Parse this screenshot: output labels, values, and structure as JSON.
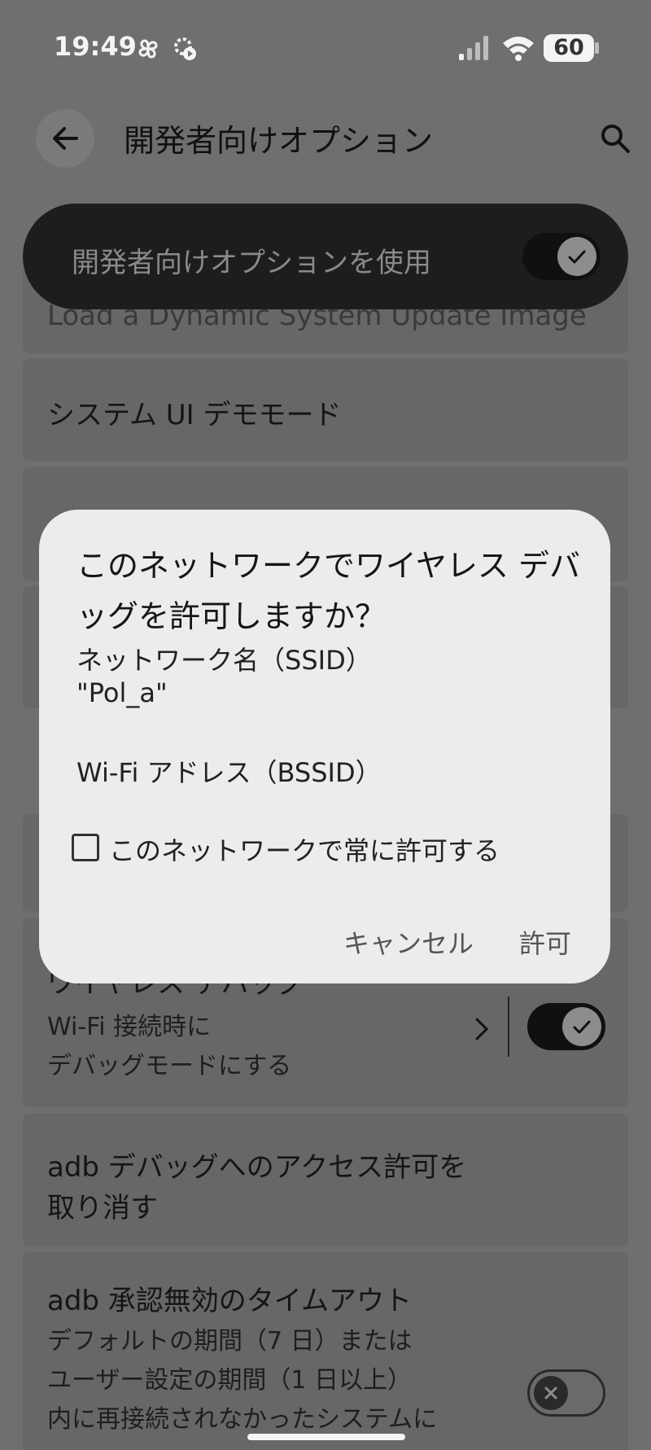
{
  "status_bar": {
    "time": "19:49",
    "battery": "60"
  },
  "header": {
    "title": "開発者向けオプション"
  },
  "master_toggle": {
    "label": "開発者向けオプションを使用",
    "state": "on"
  },
  "list": {
    "dsu_label": "Load a Dynamic System Update Image",
    "demo_mode": "システム UI デモモード",
    "wireless_debug": {
      "title": "ワイヤレス デバッグ",
      "subtitle_1": "Wi-Fi 接続時に",
      "subtitle_2": "デバッグモードにする",
      "state": "on"
    },
    "revoke_adb": {
      "line_1": "adb デバッグへのアクセス許可を",
      "line_2": "取り消す"
    },
    "adb_timeout": {
      "title": "adb 承認無効のタイムアウト",
      "sub_1": "デフォルトの期間（7 日）または",
      "sub_2": "ユーザー設定の期間（1 日以上）",
      "sub_3": "内に再接続されなかったシステムに",
      "state": "off"
    }
  },
  "dialog": {
    "title": "このネットワークでワイヤレス デバッグを許可しますか？",
    "ssid_label": "ネットワーク名（SSID）",
    "ssid_value": "\"Pol_a\"",
    "bssid_label": "Wi-Fi アドレス（BSSID）",
    "always_allow_label": "このネットワークで常に許可する",
    "cancel_label": "キャンセル",
    "allow_label": "許可"
  }
}
